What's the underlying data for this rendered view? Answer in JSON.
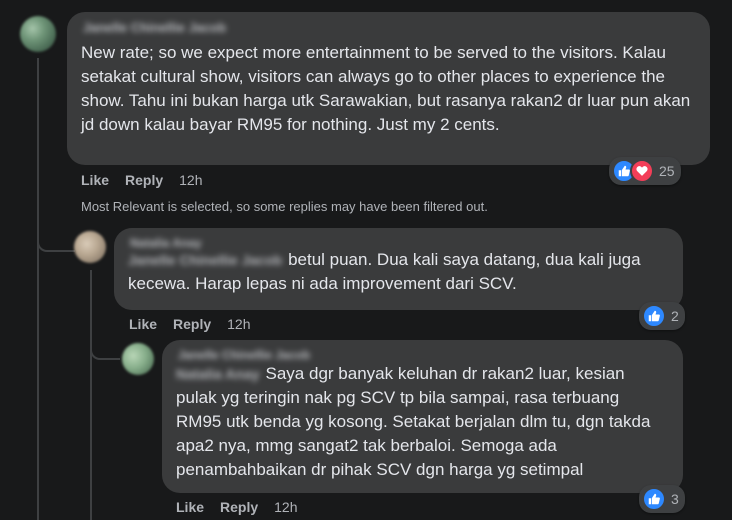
{
  "comments": {
    "main": {
      "author": "Janelle Chinellie Jacob",
      "text": "New rate; so we expect more entertainment to be served to the visitors. Kalau setakat cultural show, visitors can always go to other places to experience the show. Tahu ini bukan harga utk Sarawakian, but rasanya rakan2 dr luar pun akan jd down kalau bayar RM95 for nothing. Just my 2 cents.",
      "like_label": "Like",
      "reply_label": "Reply",
      "time": "12h",
      "reaction_count": "25",
      "reaction_icons": [
        "like-icon",
        "love-icon"
      ]
    },
    "filter_note": "Most Relevant is selected, so some replies may have been filtered out.",
    "reply1": {
      "author": "Natalia Anay",
      "mention": "Janelle Chinellie Jacob",
      "text": "betul puan. Dua kali saya datang, dua kali juga kecewa. Harap lepas ni ada improvement dari SCV.",
      "like_label": "Like",
      "reply_label": "Reply",
      "time": "12h",
      "reaction_count": "2",
      "reaction_icons": [
        "like-icon"
      ]
    },
    "reply2": {
      "author": "Janelle Chinellie Jacob",
      "mention": "Natalia Anay",
      "text": "Saya dgr banyak keluhan dr rakan2 luar, kesian pulak yg teringin nak pg SCV tp bila sampai, rasa terbuang RM95 utk benda yg kosong. Setakat berjalan dlm tu, dgn takda apa2 nya, mmg sangat2 tak berbaloi. Semoga ada penambahbaikan dr pihak SCV dgn harga yg setimpal",
      "like_label": "Like",
      "reply_label": "Reply",
      "time": "12h",
      "reaction_count": "3",
      "reaction_icons": [
        "like-icon"
      ]
    }
  },
  "colors": {
    "background": "#18191a",
    "bubble": "#3a3b3c",
    "text": "#e4e6eb",
    "secondary_text": "#b0b3b8",
    "like_blue": "#2d88ff",
    "love_red": "#f33e58"
  }
}
